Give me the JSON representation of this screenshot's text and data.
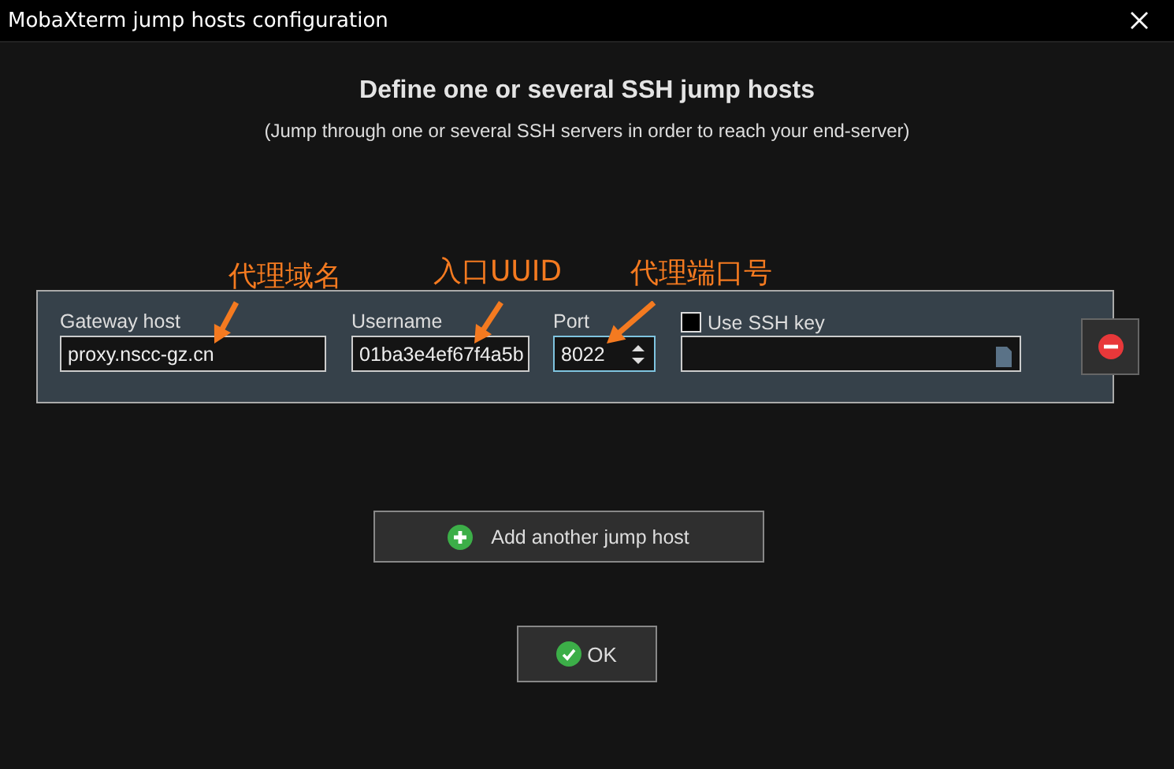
{
  "window": {
    "title": "MobaXterm jump hosts configuration"
  },
  "heading": "Define one or several SSH jump hosts",
  "subtitle": "(Jump through one or several SSH servers in order to reach your end-server)",
  "annotations": [
    {
      "text": "代理域名"
    },
    {
      "text": "入口UUID"
    },
    {
      "text": "代理端口号"
    }
  ],
  "jump_hosts": [
    {
      "gateway_host": {
        "label": "Gateway host",
        "value": "proxy.nscc-gz.cn"
      },
      "username": {
        "label": "Username",
        "value": "01ba3e4ef67f4a5b"
      },
      "port": {
        "label": "Port",
        "value": "8022",
        "focused": true
      },
      "use_ssh_key": {
        "label": "Use SSH key",
        "checked": false
      }
    }
  ],
  "add_button": "Add another jump host",
  "ok_button": "OK"
}
